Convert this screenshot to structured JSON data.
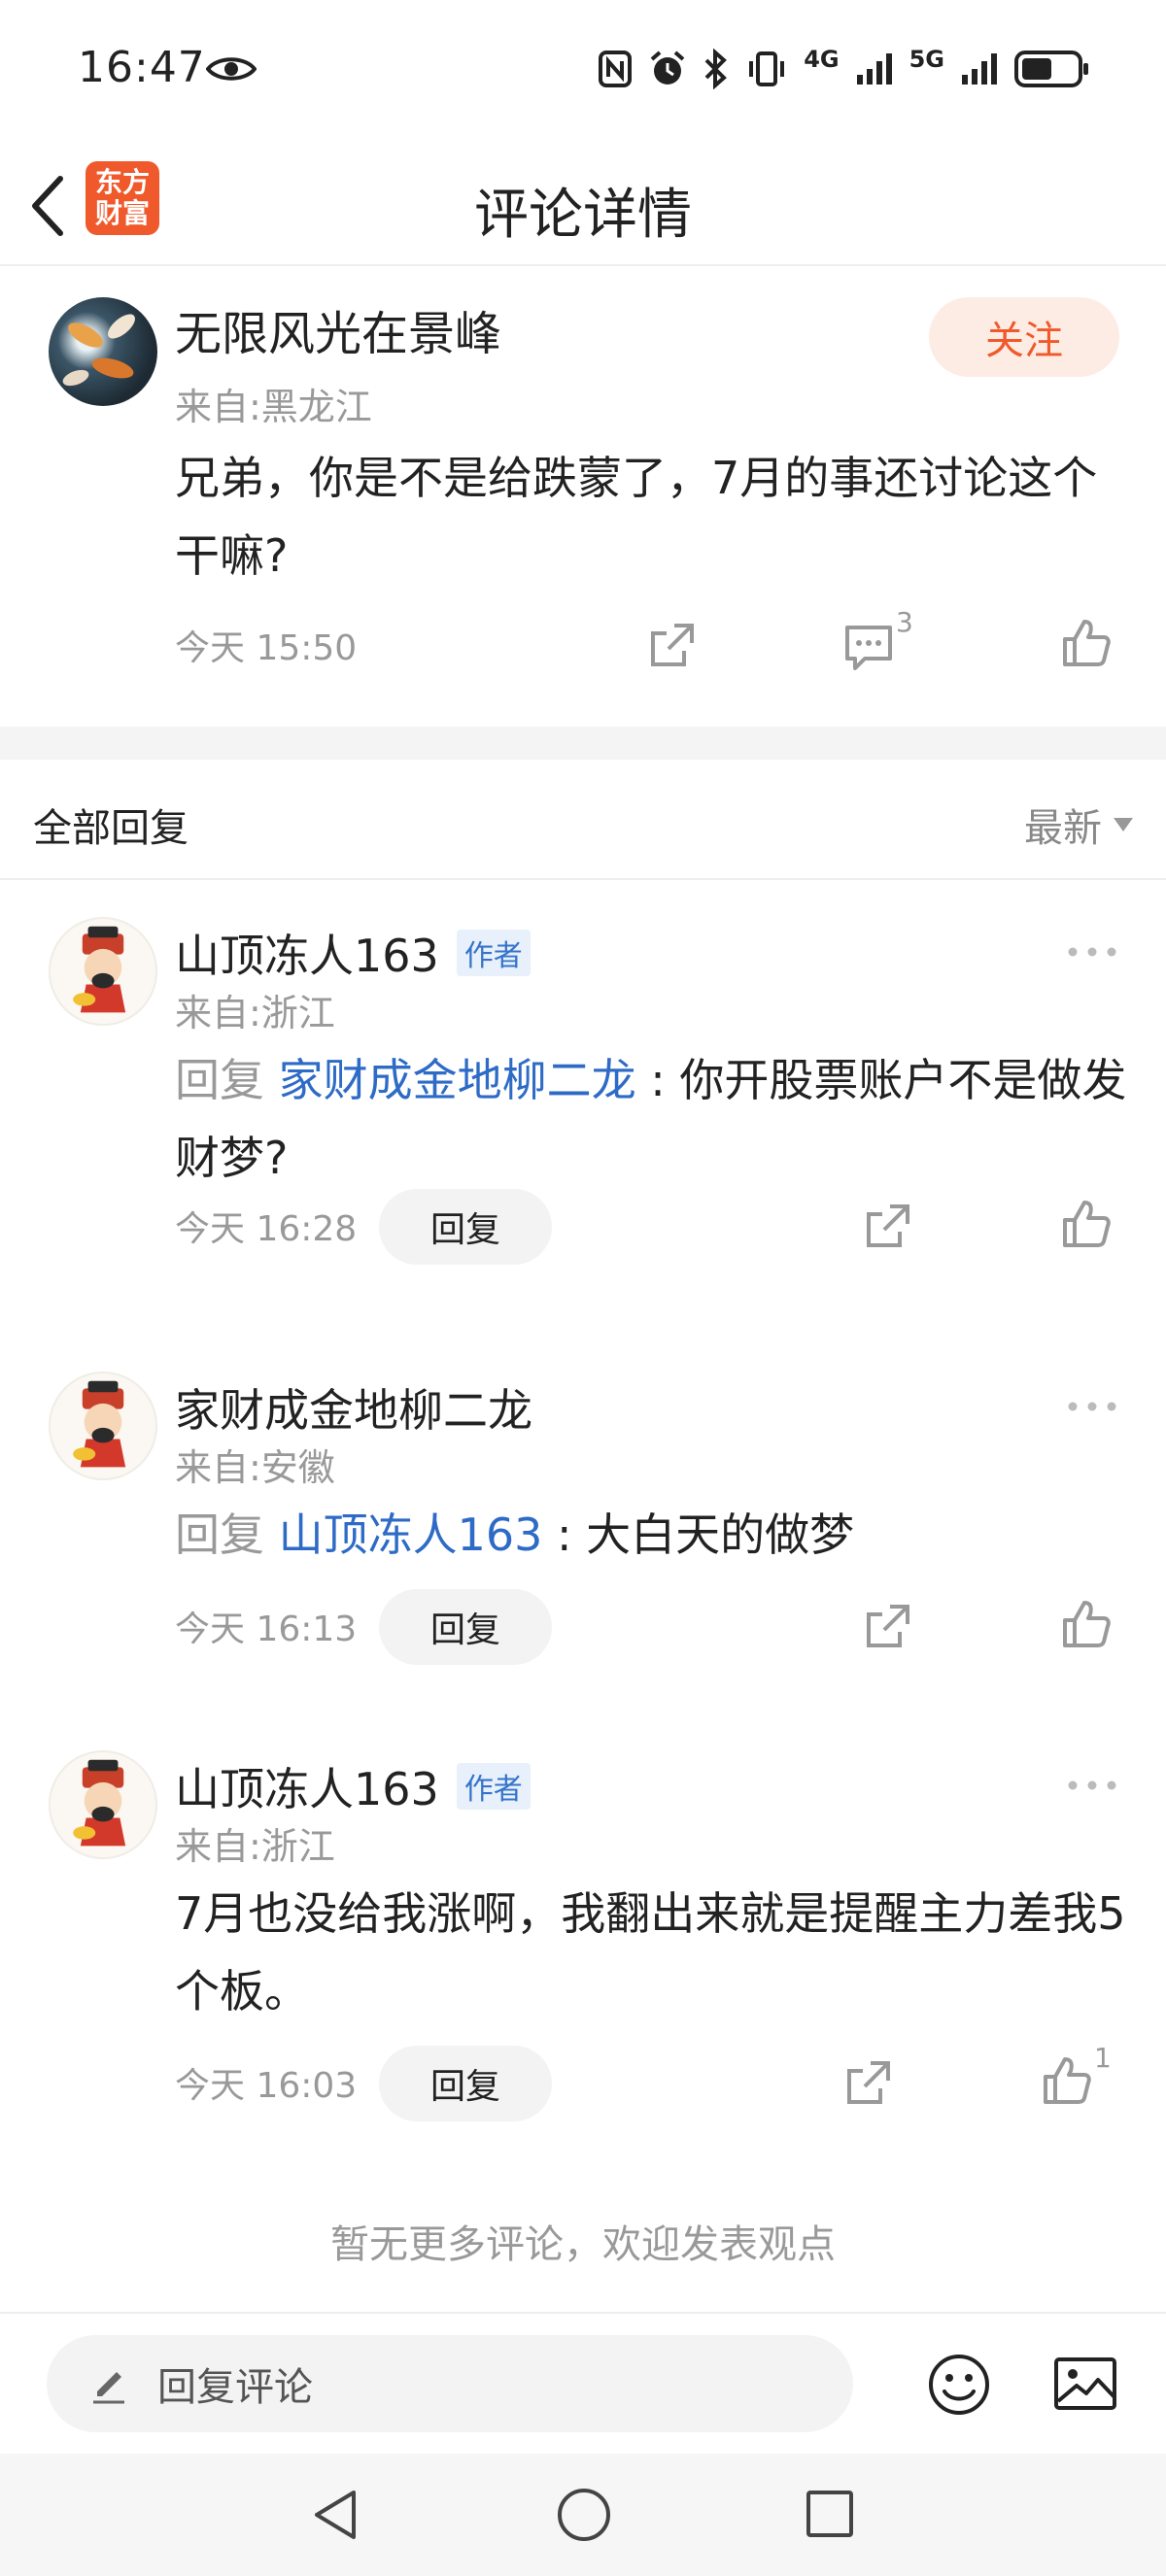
{
  "status_bar": {
    "time": "16:47",
    "network_1": "4G",
    "network_2": "5G"
  },
  "header": {
    "title": "评论详情",
    "logo_line1": "东方",
    "logo_line2": "财富"
  },
  "main_comment": {
    "author": "无限风光在景峰",
    "from": "来自:黑龙江",
    "follow_label": "关注",
    "text": "兄弟，你是不是给跌蒙了，7月的事还讨论这个干嘛?",
    "time": "今天 15:50",
    "comment_count": "3"
  },
  "replies_header": {
    "title": "全部回复",
    "sort_label": "最新"
  },
  "replies": [
    {
      "author": "山顶冻人163",
      "badge": "作者",
      "from": "来自:浙江",
      "prefix": "回复 ",
      "target": "家财成金地柳二龙",
      "text": " : 你开股票账户不是做发财梦?",
      "time": "今天 16:28",
      "reply_label": "回复",
      "like_count": ""
    },
    {
      "author": "家财成金地柳二龙",
      "badge": "",
      "from": "来自:安徽",
      "prefix": "回复 ",
      "target": "山顶冻人163",
      "text": " : 大白天的做梦",
      "time": "今天 16:13",
      "reply_label": "回复",
      "like_count": ""
    },
    {
      "author": "山顶冻人163",
      "badge": "作者",
      "from": "来自:浙江",
      "prefix": "",
      "target": "",
      "text": "7月也没给我涨啊，我翻出来就是提醒主力差我5个板。",
      "time": "今天 16:03",
      "reply_label": "回复",
      "like_count": "1"
    }
  ],
  "footer": {
    "no_more": "暂无更多评论，欢迎发表观点",
    "input_placeholder": "回复评论"
  },
  "colors": {
    "accent": "#f0592b",
    "link": "#2e6bc6",
    "muted": "#999999"
  }
}
